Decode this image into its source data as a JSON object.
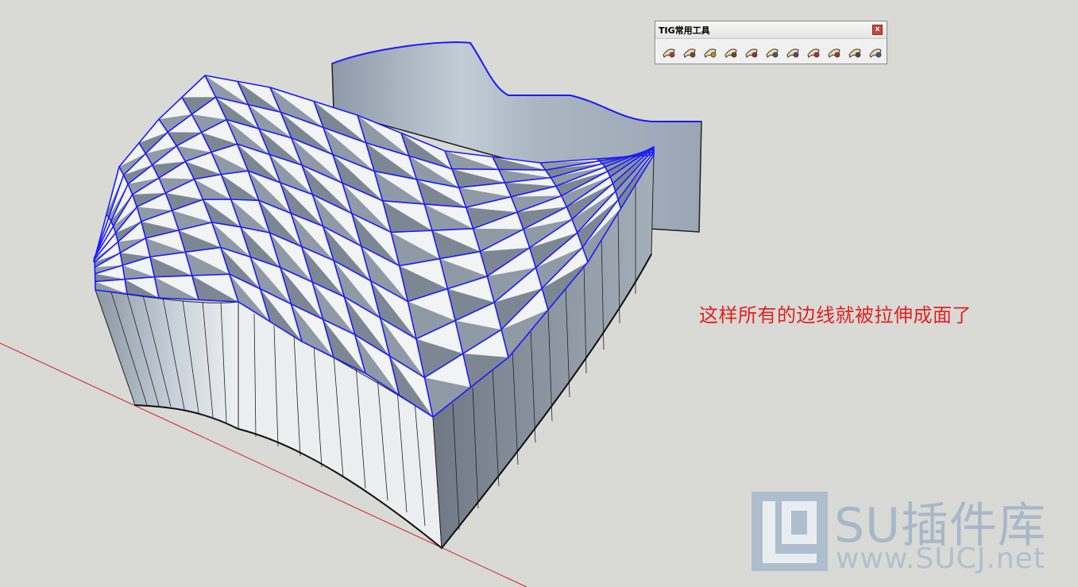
{
  "toolbar": {
    "title": "TIG常用工具",
    "close_label": "x",
    "tools": [
      {
        "icon": "surface-tool-1-icon"
      },
      {
        "icon": "surface-tool-2-icon"
      },
      {
        "icon": "surface-tool-3-icon"
      },
      {
        "icon": "surface-tool-4-icon"
      },
      {
        "icon": "surface-tool-5-icon"
      },
      {
        "icon": "surface-tool-6-icon"
      },
      {
        "icon": "surface-tool-7-icon"
      },
      {
        "icon": "surface-tool-8-icon"
      },
      {
        "icon": "surface-tool-9-icon"
      },
      {
        "icon": "surface-tool-10-icon"
      },
      {
        "icon": "surface-tool-11-icon"
      }
    ]
  },
  "caption": "这样所有的边线就被拉伸成面了",
  "watermark": {
    "brand": "SU插件库",
    "url": "www.SUCJ.net"
  },
  "colors": {
    "background": "#d9d9d6",
    "edge_highlight": "#1a1aff",
    "caption_red": "#e0221e",
    "axis_red": "#d22020"
  }
}
